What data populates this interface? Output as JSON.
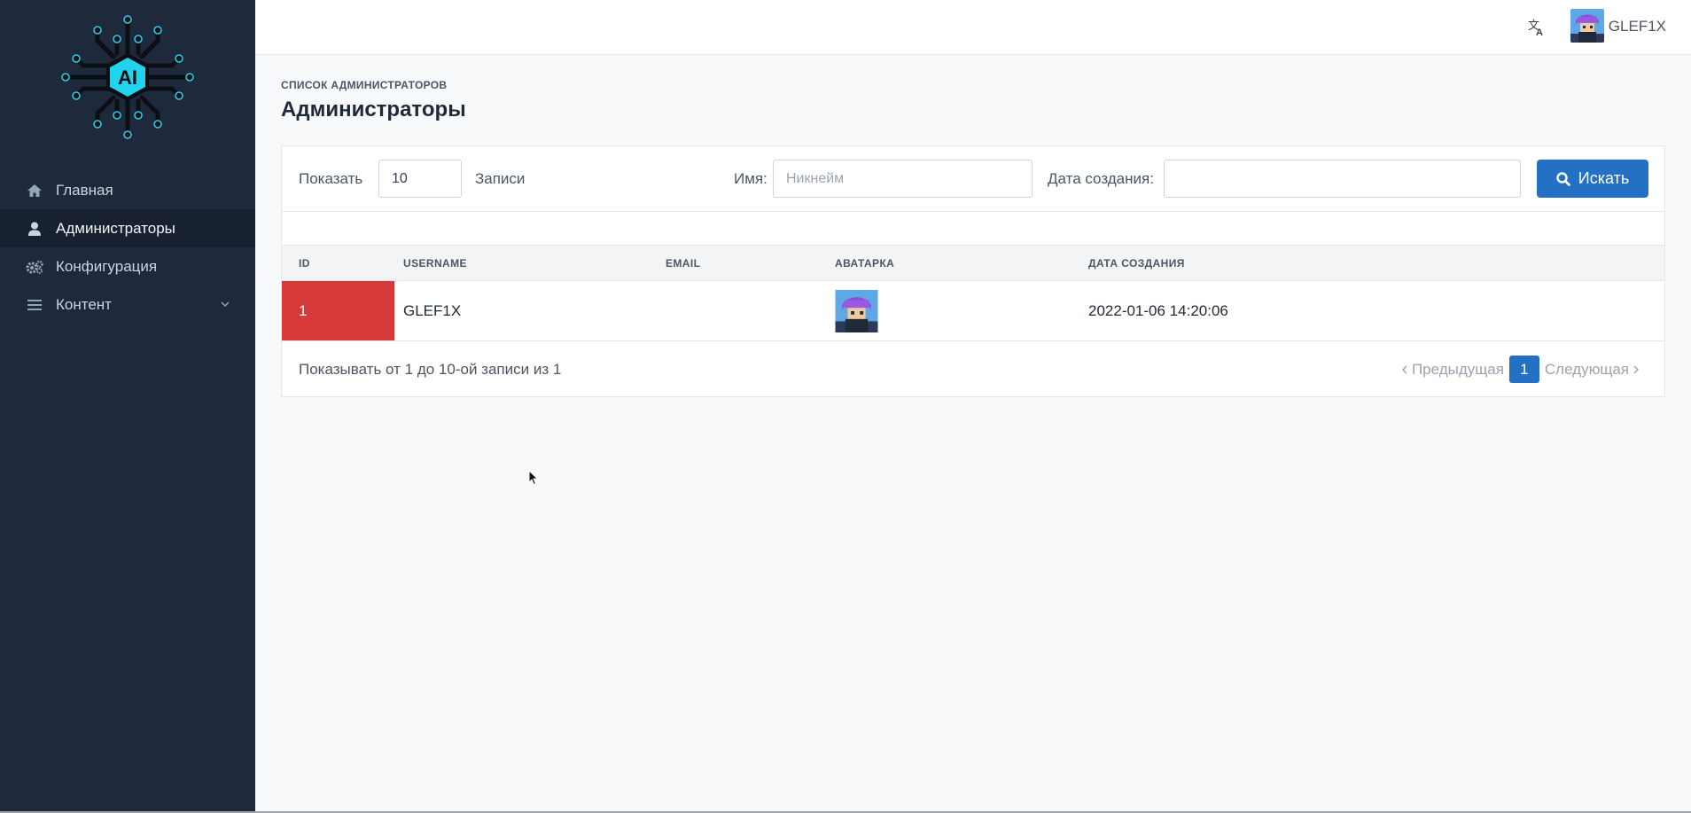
{
  "sidebar": {
    "logo_text": "AI",
    "items": [
      {
        "label": "Главная",
        "icon": "home-icon"
      },
      {
        "label": "Администраторы",
        "icon": "user-icon",
        "active": true
      },
      {
        "label": "Конфигурация",
        "icon": "gears-icon"
      },
      {
        "label": "Контент",
        "icon": "bars-icon",
        "has_submenu": true
      }
    ]
  },
  "header": {
    "translate_icon": "translate-icon",
    "username": "GLEF1X"
  },
  "page": {
    "breadcrumb": "СПИСОК АДМИНИСТРАТОРОВ",
    "title": "Администраторы"
  },
  "filters": {
    "show_label": "Показать",
    "show_value": "10",
    "records_label": "Записи",
    "name_label": "Имя:",
    "name_placeholder": "Никнейм",
    "name_value": "",
    "date_label": "Дата создания:",
    "date_value": "",
    "search_label": "Искать"
  },
  "table": {
    "columns": [
      "ID",
      "USERNAME",
      "EMAIL",
      "АВАТАРКА",
      "ДАТА СОЗДАНИЯ"
    ],
    "rows": [
      {
        "id": "1",
        "username": "GLEF1X",
        "email": "",
        "avatar": "avatar-image",
        "created": "2022-01-06 14:20:06"
      }
    ]
  },
  "footer": {
    "info": "Показывать от 1 до 10-ой записи из 1",
    "prev_label": "Предыдущая",
    "current_page": "1",
    "next_label": "Следующая"
  },
  "colors": {
    "sidebar_bg": "#1e293b",
    "primary": "#2470c4",
    "id_cell": "#d63939",
    "logo_accent": "#22d3ee"
  }
}
